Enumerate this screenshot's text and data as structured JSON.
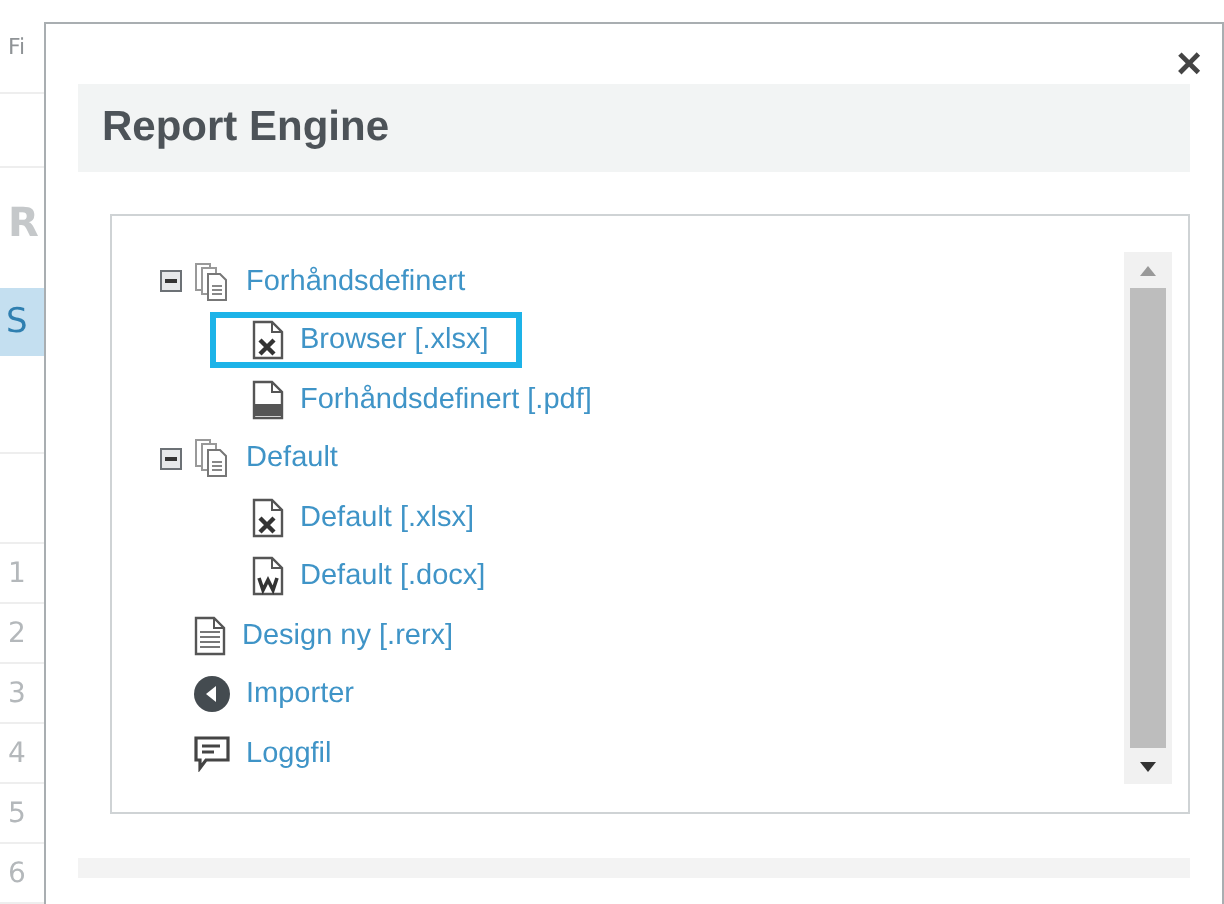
{
  "background_page": {
    "header_text": "Fi",
    "section_letter": "R",
    "tab": {
      "label": "S",
      "selected": true
    },
    "row_numbers": [
      "1",
      "2",
      "3",
      "4",
      "5",
      "6"
    ]
  },
  "dialog": {
    "close": "×",
    "title": "Report Engine",
    "tree": [
      {
        "kind": "group",
        "label": "Forhåndsdefinert",
        "expanded": true,
        "selected": false,
        "children": [
          {
            "kind": "excel",
            "label": "Browser [.xlsx]",
            "selected": true
          },
          {
            "kind": "pdf",
            "label": "Forhåndsdefinert [.pdf]",
            "selected": false
          }
        ]
      },
      {
        "kind": "group",
        "label": "Default",
        "expanded": true,
        "selected": false,
        "children": [
          {
            "kind": "excel",
            "label": "Default [.xlsx]",
            "selected": false
          },
          {
            "kind": "word",
            "label": "Default [.docx]",
            "selected": false
          }
        ]
      },
      {
        "kind": "document",
        "label": "Design ny [.rerx]",
        "selected": false
      },
      {
        "kind": "import",
        "label": "Importer",
        "selected": false
      },
      {
        "kind": "log",
        "label": "Loggfil",
        "selected": false
      }
    ]
  }
}
